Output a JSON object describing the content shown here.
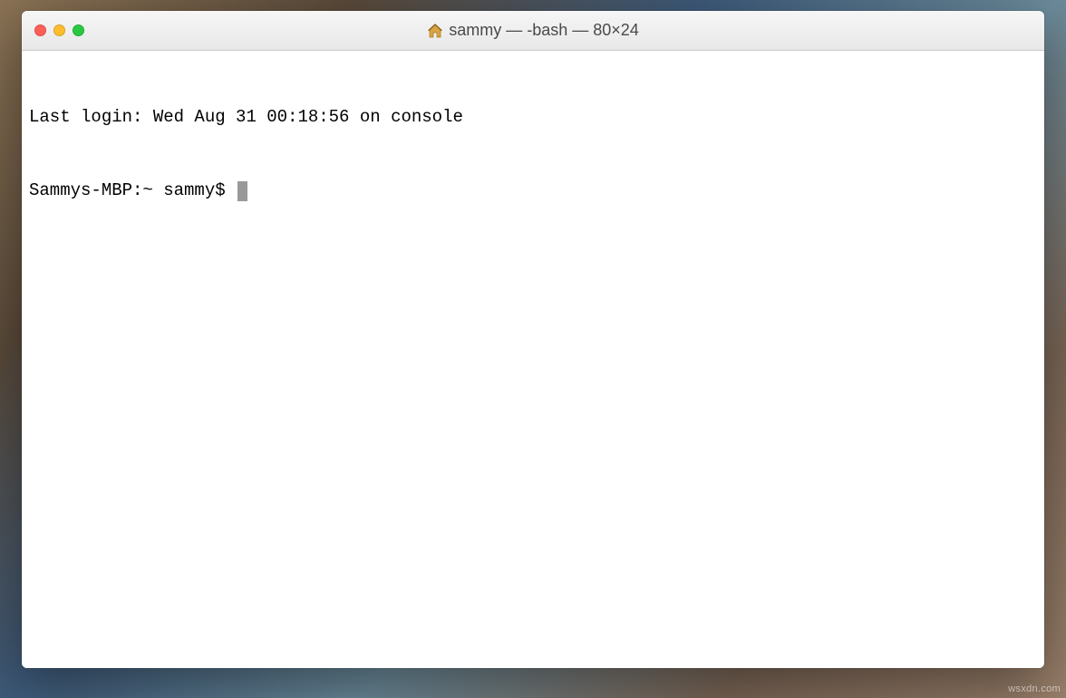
{
  "window": {
    "title": "sammy — -bash — 80×24"
  },
  "terminal": {
    "last_login_line": "Last login: Wed Aug 31 00:18:56 on console",
    "prompt": "Sammys-MBP:~ sammy$ "
  },
  "watermark": "wsxdn.com"
}
